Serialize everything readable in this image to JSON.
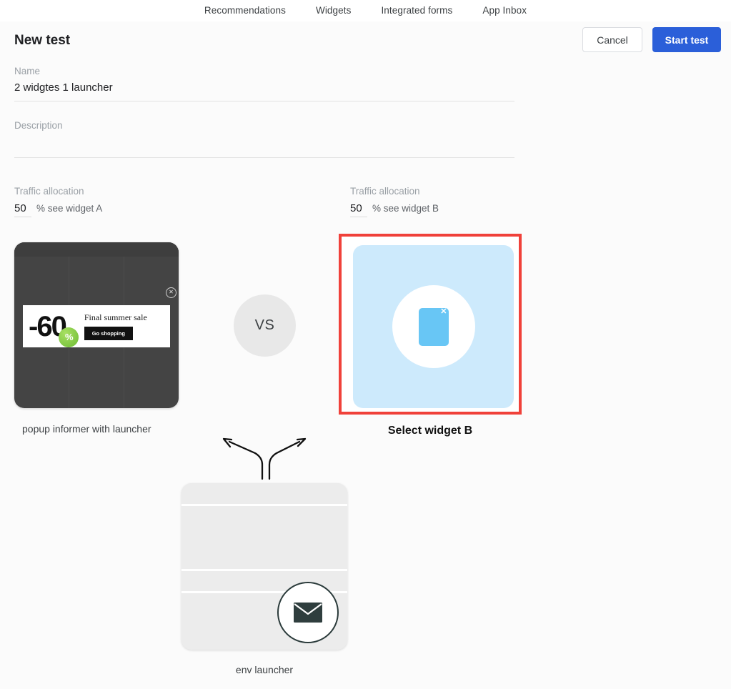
{
  "topnav": {
    "items": [
      {
        "label": "Recommendations",
        "name": "nav-recommendations"
      },
      {
        "label": "Widgets",
        "name": "nav-widgets"
      },
      {
        "label": "Integrated forms",
        "name": "nav-integrated-forms"
      },
      {
        "label": "App Inbox",
        "name": "nav-app-inbox"
      }
    ]
  },
  "header": {
    "title": "New test",
    "cancel_label": "Cancel",
    "start_label": "Start test"
  },
  "form": {
    "name_label": "Name",
    "name_value": "2 widgtes 1 launcher",
    "description_label": "Description",
    "description_value": ""
  },
  "traffic": {
    "variant_a": {
      "label": "Traffic allocation",
      "value": "50",
      "suffix": "% see widget A"
    },
    "variant_b": {
      "label": "Traffic allocation",
      "value": "50",
      "suffix": "% see widget B"
    }
  },
  "comparison": {
    "vs_label": "VS",
    "variant_a": {
      "caption": "popup informer with launcher",
      "discount": "-60",
      "percent": "%",
      "sale_text": "Final summer sale",
      "cta_label": "Go shopping",
      "close_icon": "close-circle-icon"
    },
    "variant_b": {
      "caption": "Select widget B",
      "placeholder_icon": "widget-placeholder-icon",
      "close_icon": "close-icon",
      "border_color": "#f0413a"
    }
  },
  "launcher": {
    "caption": "env launcher",
    "icon": "envelope-icon"
  },
  "colors": {
    "accent": "#2b5fd9",
    "selection_border": "#f0413a",
    "widget_b_bg": "#cdeafc",
    "widget_b_shape": "#68c6f5",
    "widget_a_bg": "#444444",
    "page_bg": "#fbfbfb"
  }
}
